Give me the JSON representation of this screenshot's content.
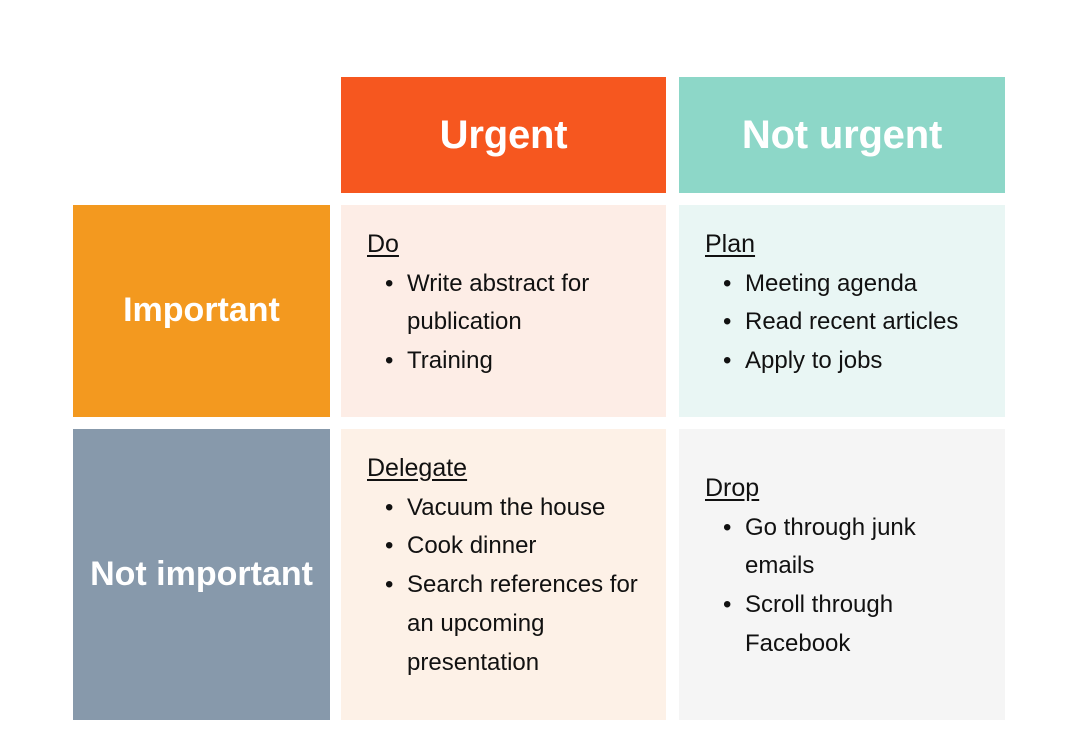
{
  "diagram": {
    "type": "eisenhower-matrix",
    "colors": {
      "urgent_header_bg": "#F6571F",
      "not_urgent_header_bg": "#8DD7C8",
      "important_header_bg": "#F3991F",
      "not_important_header_bg": "#8799AB",
      "do_cell_bg": "#FDEDE6",
      "plan_cell_bg": "#E9F6F4",
      "delegate_cell_bg": "#FDF1E7",
      "drop_cell_bg": "#F5F5F5",
      "header_text": "#FFFFFF",
      "body_text": "#111111",
      "page_bg": "#FFFFFF"
    },
    "column_headers": [
      {
        "id": "urgent",
        "label": "Urgent"
      },
      {
        "id": "not-urgent",
        "label": "Not urgent"
      }
    ],
    "row_headers": [
      {
        "id": "important",
        "label": "Important"
      },
      {
        "id": "not-important",
        "label": "Not important"
      }
    ],
    "bullet_glyph": "•",
    "quadrants": [
      {
        "id": "do",
        "title": "Do",
        "row": "Important",
        "column": "Urgent",
        "tasks": [
          "Write abstract for publication",
          "Training"
        ]
      },
      {
        "id": "plan",
        "title": "Plan",
        "row": "Important",
        "column": "Not urgent",
        "tasks": [
          "Meeting agenda",
          "Read recent articles",
          "Apply to jobs"
        ]
      },
      {
        "id": "delegate",
        "title": "Delegate",
        "row": "Not important",
        "column": "Urgent",
        "tasks": [
          "Vacuum the house",
          "Cook dinner",
          "Search references for an upcoming presentation"
        ]
      },
      {
        "id": "drop",
        "title": "Drop",
        "row": "Not important",
        "column": "Not urgent",
        "tasks": [
          "Go through junk emails",
          "Scroll through Facebook"
        ]
      }
    ]
  }
}
